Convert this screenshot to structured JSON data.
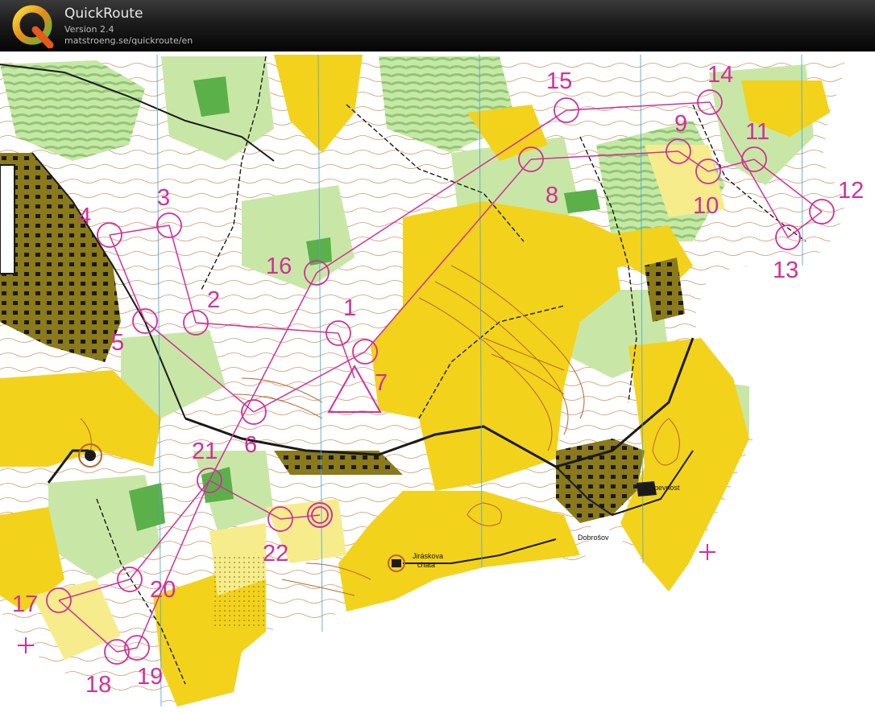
{
  "app": {
    "title": "QuickRoute",
    "version": "Version 2.4",
    "url": "matstroeng.se/quickroute/en",
    "logo_letter": "Q"
  },
  "map": {
    "place_names": {
      "chata_line1": "Jiráskova",
      "chata_line2": "chata",
      "village": "Dobrošov",
      "fortress": "pevnost"
    },
    "controls": [
      "1",
      "2",
      "3",
      "4",
      "5",
      "6",
      "7",
      "8",
      "9",
      "10",
      "11",
      "12",
      "13",
      "14",
      "15",
      "16",
      "17",
      "18",
      "19",
      "20",
      "21",
      "22"
    ],
    "colors": {
      "course_magenta": "#d0309a",
      "open_land_yellow": "#f3d21c",
      "rough_open_yellow": "#f7ec8c",
      "forest_green_light": "#c8e7a6",
      "forest_green_dark": "#5bb04a",
      "contour_brown": "#b5652b",
      "buildings_black": "#1a1a1a",
      "magnetic_north_blue": "#4aa8d8"
    }
  }
}
